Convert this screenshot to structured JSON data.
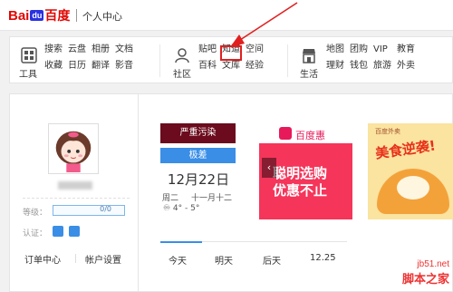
{
  "header": {
    "logo_bai": "Bai",
    "logo_paw": "du",
    "logo_du": "百度",
    "title": "个人中心"
  },
  "nav": {
    "group1": [
      "搜索",
      "云盘",
      "相册",
      "文档",
      "工具",
      "收藏",
      "日历",
      "翻译",
      "影音"
    ],
    "group2": [
      "贴吧",
      "知道",
      "空间",
      "社区",
      "百科",
      "文库",
      "经验"
    ],
    "group3": [
      "地图",
      "团购",
      "VIP",
      "教育",
      "生活",
      "理财",
      "钱包",
      "旅游",
      "外卖"
    ]
  },
  "profile": {
    "level_label": "等级：",
    "level_value": "0/0",
    "level_progress": 0,
    "cert_label": "认证：",
    "order_center": "订单中心",
    "account_settings": "帐户设置"
  },
  "weather": {
    "pollution": "严重污染",
    "aqi_level": "极差",
    "date": "12月22日",
    "weekday": "周二",
    "lunar": "十一月十二",
    "temp": "♾ 4° - 5°"
  },
  "ads": {
    "ad1_brand": "百度惠",
    "ad1_line1": "聪明选购",
    "ad1_line2": "优惠不止",
    "ad2_small": "百度外卖",
    "ad2_title": "美食逆袭!"
  },
  "tabs": [
    "今天",
    "明天",
    "后天",
    "12.25"
  ],
  "watermark": {
    "site": "jb51.net",
    "name": "脚本之家"
  },
  "colors": {
    "accent": "#3a8ee6",
    "highlight": "#e02020",
    "pollution": "#6b0b1d"
  }
}
